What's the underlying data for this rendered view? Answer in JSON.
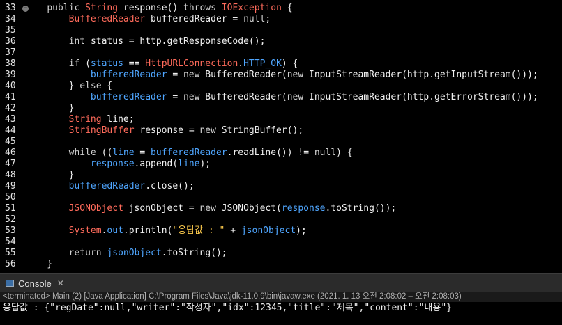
{
  "editor": {
    "fold_marker": "⊖",
    "lines": [
      {
        "n": "33",
        "t": [
          {
            "c": "    "
          },
          {
            "c": "public ",
            "k": "kw"
          },
          {
            "c": "String ",
            "k": "ty"
          },
          {
            "c": "response() "
          },
          {
            "c": "throws ",
            "k": "kw"
          },
          {
            "c": "IOException ",
            "k": "ty"
          },
          {
            "c": "{"
          }
        ]
      },
      {
        "n": "34",
        "t": [
          {
            "c": "        "
          },
          {
            "c": "BufferedReader ",
            "k": "ty"
          },
          {
            "c": "bufferedReader = "
          },
          {
            "c": "null",
            "k": "kw"
          },
          {
            "c": ";"
          }
        ]
      },
      {
        "n": "35",
        "t": []
      },
      {
        "n": "36",
        "t": [
          {
            "c": "        "
          },
          {
            "c": "int ",
            "k": "kw"
          },
          {
            "c": "status = http.getResponseCode();"
          }
        ]
      },
      {
        "n": "37",
        "t": []
      },
      {
        "n": "38",
        "t": [
          {
            "c": "        "
          },
          {
            "c": "if ",
            "k": "kw"
          },
          {
            "c": "("
          },
          {
            "c": "status",
            "k": "fld"
          },
          {
            "c": " == "
          },
          {
            "c": "HttpURLConnection",
            "k": "ty"
          },
          {
            "c": "."
          },
          {
            "c": "HTTP_OK",
            "k": "fld"
          },
          {
            "c": ") {"
          }
        ]
      },
      {
        "n": "39",
        "t": [
          {
            "c": "            "
          },
          {
            "c": "bufferedReader",
            "k": "fld"
          },
          {
            "c": " = "
          },
          {
            "c": "new ",
            "k": "kw"
          },
          {
            "c": "BufferedReader("
          },
          {
            "c": "new ",
            "k": "kw"
          },
          {
            "c": "InputStreamReader(http.getInputStream()));"
          }
        ]
      },
      {
        "n": "40",
        "t": [
          {
            "c": "        } "
          },
          {
            "c": "else ",
            "k": "kw"
          },
          {
            "c": "{"
          }
        ]
      },
      {
        "n": "41",
        "t": [
          {
            "c": "            "
          },
          {
            "c": "bufferedReader",
            "k": "fld"
          },
          {
            "c": " = "
          },
          {
            "c": "new ",
            "k": "kw"
          },
          {
            "c": "BufferedReader("
          },
          {
            "c": "new ",
            "k": "kw"
          },
          {
            "c": "InputStreamReader(http.getErrorStream()));"
          }
        ]
      },
      {
        "n": "42",
        "t": [
          {
            "c": "        }"
          }
        ]
      },
      {
        "n": "43",
        "t": [
          {
            "c": "        "
          },
          {
            "c": "String ",
            "k": "ty"
          },
          {
            "c": "line;"
          }
        ]
      },
      {
        "n": "44",
        "t": [
          {
            "c": "        "
          },
          {
            "c": "StringBuffer ",
            "k": "ty"
          },
          {
            "c": "response = "
          },
          {
            "c": "new ",
            "k": "kw"
          },
          {
            "c": "StringBuffer();"
          }
        ]
      },
      {
        "n": "45",
        "t": []
      },
      {
        "n": "46",
        "t": [
          {
            "c": "        "
          },
          {
            "c": "while ",
            "k": "kw"
          },
          {
            "c": "(("
          },
          {
            "c": "line",
            "k": "fld"
          },
          {
            "c": " = "
          },
          {
            "c": "bufferedReader",
            "k": "fld"
          },
          {
            "c": ".readLine()) != "
          },
          {
            "c": "null",
            "k": "kw"
          },
          {
            "c": ") {"
          }
        ]
      },
      {
        "n": "47",
        "t": [
          {
            "c": "            "
          },
          {
            "c": "response",
            "k": "fld"
          },
          {
            "c": ".append("
          },
          {
            "c": "line",
            "k": "fld"
          },
          {
            "c": ");"
          }
        ]
      },
      {
        "n": "48",
        "t": [
          {
            "c": "        }"
          }
        ]
      },
      {
        "n": "49",
        "t": [
          {
            "c": "        "
          },
          {
            "c": "bufferedReader",
            "k": "fld"
          },
          {
            "c": ".close();"
          }
        ]
      },
      {
        "n": "50",
        "t": []
      },
      {
        "n": "51",
        "t": [
          {
            "c": "        "
          },
          {
            "c": "JSONObject ",
            "k": "ty"
          },
          {
            "c": "jsonObject = "
          },
          {
            "c": "new ",
            "k": "kw"
          },
          {
            "c": "JSONObject("
          },
          {
            "c": "response",
            "k": "fld"
          },
          {
            "c": ".toString());"
          }
        ]
      },
      {
        "n": "52",
        "t": []
      },
      {
        "n": "53",
        "t": [
          {
            "c": "        "
          },
          {
            "c": "System",
            "k": "ty"
          },
          {
            "c": "."
          },
          {
            "c": "out",
            "k": "fld"
          },
          {
            "c": ".println("
          },
          {
            "c": "\"응답값 : \"",
            "k": "st"
          },
          {
            "c": " + "
          },
          {
            "c": "jsonObject",
            "k": "fld"
          },
          {
            "c": ");"
          }
        ]
      },
      {
        "n": "54",
        "t": []
      },
      {
        "n": "55",
        "t": [
          {
            "c": "        "
          },
          {
            "c": "return ",
            "k": "kw"
          },
          {
            "c": "jsonObject",
            "k": "fld"
          },
          {
            "c": ".toString();"
          }
        ]
      },
      {
        "n": "56",
        "t": [
          {
            "c": "    }"
          }
        ]
      }
    ]
  },
  "console": {
    "tab_label": "Console",
    "close_symbol": "✕",
    "status": "<terminated> Main (2) [Java Application] C:\\Program Files\\Java\\jdk-11.0.9\\bin\\javaw.exe  (2021. 1. 13 오전 2:08:02 – 오전 2:08:03)",
    "output": "응답값 : {\"regDate\":null,\"writer\":\"작성자\",\"idx\":12345,\"title\":\"제목\",\"content\":\"내용\"}"
  },
  "colors": {
    "keyword": "#cfcfcf",
    "type": "#ff6b5b",
    "field": "#4fa6ff",
    "string": "#ffcc4d",
    "background": "#000000"
  }
}
